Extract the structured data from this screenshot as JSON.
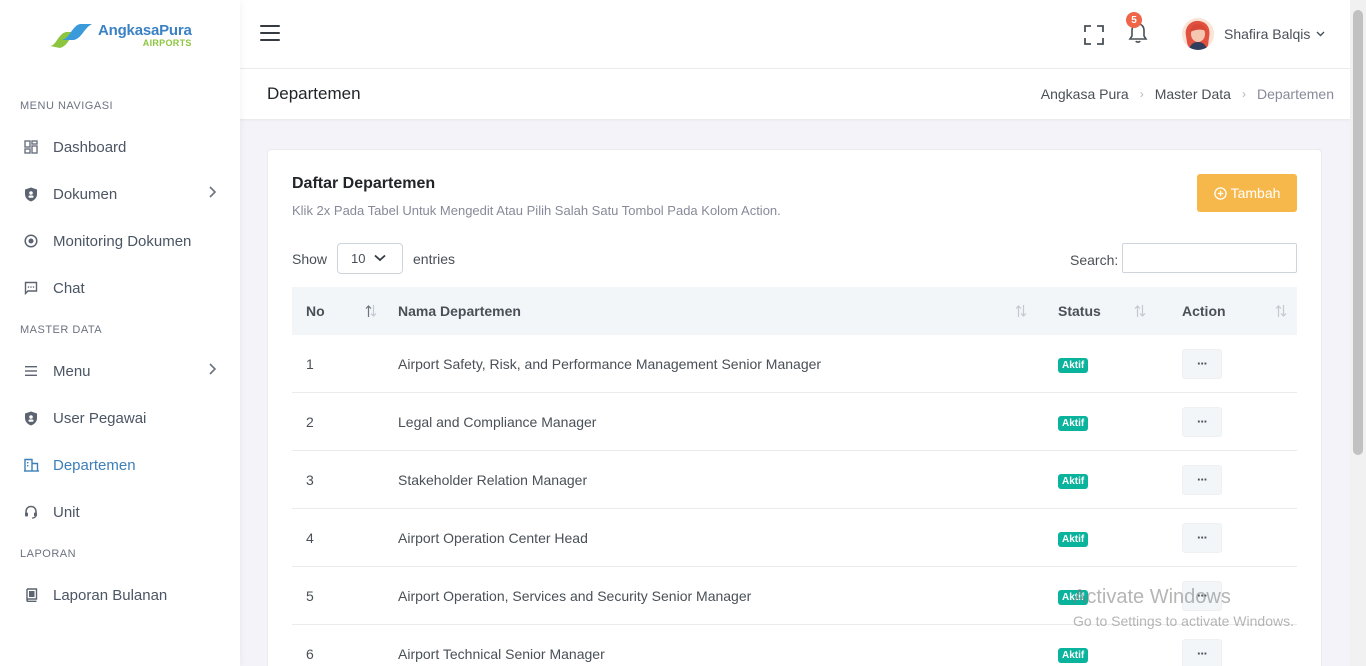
{
  "brand": {
    "logo_line1": "AngkasaPura",
    "logo_line2": "AIRPORTS"
  },
  "sidebar": {
    "section_nav": "MENU NAVIGASI",
    "section_master": "MASTER DATA",
    "section_report": "LAPORAN",
    "items": [
      {
        "label": "Dashboard",
        "icon": "dashboard-icon"
      },
      {
        "label": "Dokumen",
        "icon": "shield-icon",
        "has_submenu": true
      },
      {
        "label": "Monitoring Dokumen",
        "icon": "target-icon"
      },
      {
        "label": "Chat",
        "icon": "chat-icon"
      },
      {
        "label": "Menu",
        "icon": "list-icon",
        "has_submenu": true
      },
      {
        "label": "User Pegawai",
        "icon": "shield-icon"
      },
      {
        "label": "Departemen",
        "icon": "building-icon",
        "active": true
      },
      {
        "label": "Unit",
        "icon": "headset-icon"
      },
      {
        "label": "Laporan Bulanan",
        "icon": "book-icon"
      }
    ]
  },
  "topbar": {
    "notification_count": "5",
    "user_name": "Shafira Balqis"
  },
  "page": {
    "title": "Departemen",
    "breadcrumb": [
      "Angkasa Pura",
      "Master Data",
      "Departemen"
    ]
  },
  "card": {
    "title": "Daftar Departemen",
    "subtitle": "Klik 2x Pada Tabel Untuk Mengedit Atau Pilih Salah Satu Tombol Pada Kolom Action.",
    "add_button": "Tambah",
    "show_label": "Show",
    "entries_value": "10",
    "entries_label": "entries",
    "search_label": "Search:",
    "search_value": ""
  },
  "table": {
    "headers": [
      "No",
      "Nama Departemen",
      "Status",
      "Action"
    ],
    "rows": [
      {
        "no": "1",
        "name": "Airport Safety, Risk, and Performance Management Senior Manager",
        "status": "Aktif",
        "action": "···"
      },
      {
        "no": "2",
        "name": "Legal and Compliance Manager",
        "status": "Aktif",
        "action": "···"
      },
      {
        "no": "3",
        "name": "Stakeholder Relation Manager",
        "status": "Aktif",
        "action": "···"
      },
      {
        "no": "4",
        "name": "Airport Operation Center Head",
        "status": "Aktif",
        "action": "···"
      },
      {
        "no": "5",
        "name": "Airport Operation, Services and Security Senior Manager",
        "status": "Aktif",
        "action": "···"
      },
      {
        "no": "6",
        "name": "Airport Technical Senior Manager",
        "status": "Aktif",
        "action": "···"
      }
    ]
  },
  "watermark": {
    "line1": "Activate Windows",
    "line2": "Go to Settings to activate Windows."
  },
  "colors": {
    "accent": "#3d7fb8",
    "warning": "#f7b84b",
    "success": "#0ab39c",
    "danger": "#f06548"
  }
}
